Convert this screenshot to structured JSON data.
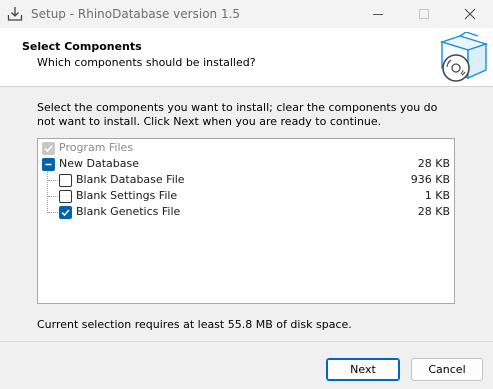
{
  "window": {
    "title": "Setup - RhinoDatabase version 1.5"
  },
  "header": {
    "title": "Select Components",
    "subtitle": "Which components should be installed?"
  },
  "intro": "Select the components you want to install; clear the components you do not want to install. Click Next when you are ready to continue.",
  "components": [
    {
      "label": "Program Files",
      "size": "",
      "state": "disabled-checked"
    },
    {
      "label": "New Database",
      "size": "28 KB",
      "state": "partial"
    },
    {
      "label": "Blank Database File",
      "size": "936 KB",
      "state": "unchecked"
    },
    {
      "label": "Blank Settings File",
      "size": "1 KB",
      "state": "unchecked"
    },
    {
      "label": "Blank Genetics File",
      "size": "28 KB",
      "state": "checked"
    }
  ],
  "disk_space": "Current selection requires at least 55.8 MB of disk space.",
  "buttons": {
    "next": "Next",
    "cancel": "Cancel"
  },
  "colors": {
    "accent": "#0063b1",
    "header_bg": "#ffffff",
    "window_bg": "#f0f0f0"
  },
  "icons": {
    "app": "download-tray-icon",
    "header": "software-box-with-disc-icon"
  }
}
